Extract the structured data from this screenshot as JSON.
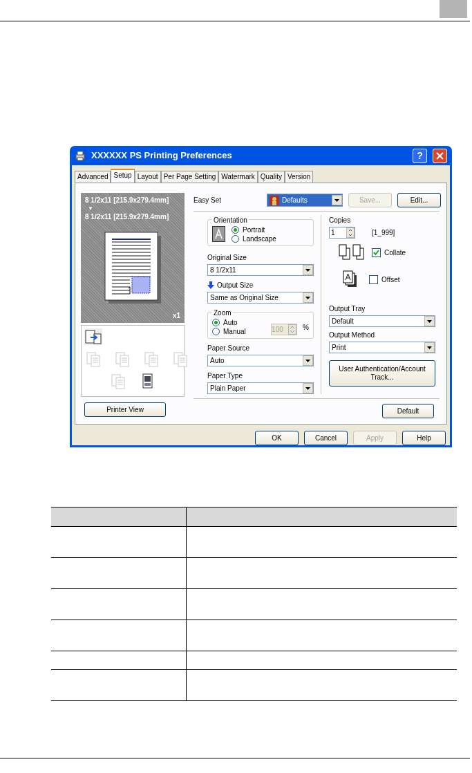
{
  "dialog": {
    "title": "XXXXXX  PS Printing Preferences",
    "help_button": "?",
    "tabs": [
      {
        "label": "Advanced",
        "selected": false
      },
      {
        "label": "Setup",
        "selected": true
      },
      {
        "label": "Layout",
        "selected": false
      },
      {
        "label": "Per Page Setting",
        "selected": false
      },
      {
        "label": "Watermark",
        "selected": false
      },
      {
        "label": "Quality",
        "selected": false
      },
      {
        "label": "Version",
        "selected": false
      }
    ],
    "preview": {
      "original_size": "8 1/2x11 [215.9x279.4mm]",
      "arrow": "▼",
      "output_size": "8 1/2x11 [215.9x279.4mm]",
      "count": "x1"
    },
    "view_modes": [
      {
        "selected": true,
        "disabled": false
      },
      {
        "selected": false,
        "disabled": true
      },
      {
        "selected": false,
        "disabled": true
      },
      {
        "selected": false,
        "disabled": true
      },
      {
        "selected": false,
        "disabled": true
      },
      {
        "selected": false,
        "disabled": true
      },
      {
        "selected": false,
        "disabled": false
      }
    ],
    "printer_view_button": "Printer View",
    "easy_set": {
      "label": "Easy Set",
      "value": "Defaults",
      "buttons": [
        {
          "label": "Save...",
          "disabled": true
        },
        {
          "label": "Edit...",
          "disabled": false
        }
      ]
    },
    "orientation": {
      "title": "Orientation",
      "options": [
        {
          "label": "Portrait",
          "selected": true
        },
        {
          "label": "Landscape",
          "selected": false
        }
      ]
    },
    "original_size": {
      "label": "Original Size",
      "value": "8 1/2x11"
    },
    "output_size": {
      "label": "Output Size",
      "value": "Same as Original Size"
    },
    "zoom": {
      "title": "Zoom",
      "options": [
        {
          "label": "Auto",
          "selected": true
        },
        {
          "label": "Manual",
          "selected": false
        }
      ],
      "value": "100",
      "disabled": true,
      "unit": "%"
    },
    "paper_source": {
      "label": "Paper Source",
      "value": "Auto"
    },
    "paper_type": {
      "label": "Paper Type",
      "value": "Plain Paper"
    },
    "copies": {
      "label": "Copies",
      "value": "1",
      "range": "[1_999]"
    },
    "collate": {
      "label": "Collate",
      "checked": true
    },
    "offset": {
      "label": "Offset",
      "checked": false
    },
    "output_tray": {
      "label": "Output Tray",
      "value": "Default"
    },
    "output_method": {
      "label": "Output Method",
      "value": "Print"
    },
    "auth_button": "User Authentication/Account Track...",
    "default_button": "Default",
    "footer_buttons": [
      {
        "label": "OK",
        "disabled": false
      },
      {
        "label": "Cancel",
        "disabled": false
      },
      {
        "label": "Apply",
        "disabled": true
      },
      {
        "label": "Help",
        "disabled": false
      }
    ]
  },
  "table": {
    "rows": [
      {
        "kind": "header"
      },
      {
        "kind": "double"
      },
      {
        "kind": "double"
      },
      {
        "kind": "double"
      },
      {
        "kind": "double"
      },
      {
        "kind": "single"
      },
      {
        "kind": "double"
      }
    ]
  }
}
